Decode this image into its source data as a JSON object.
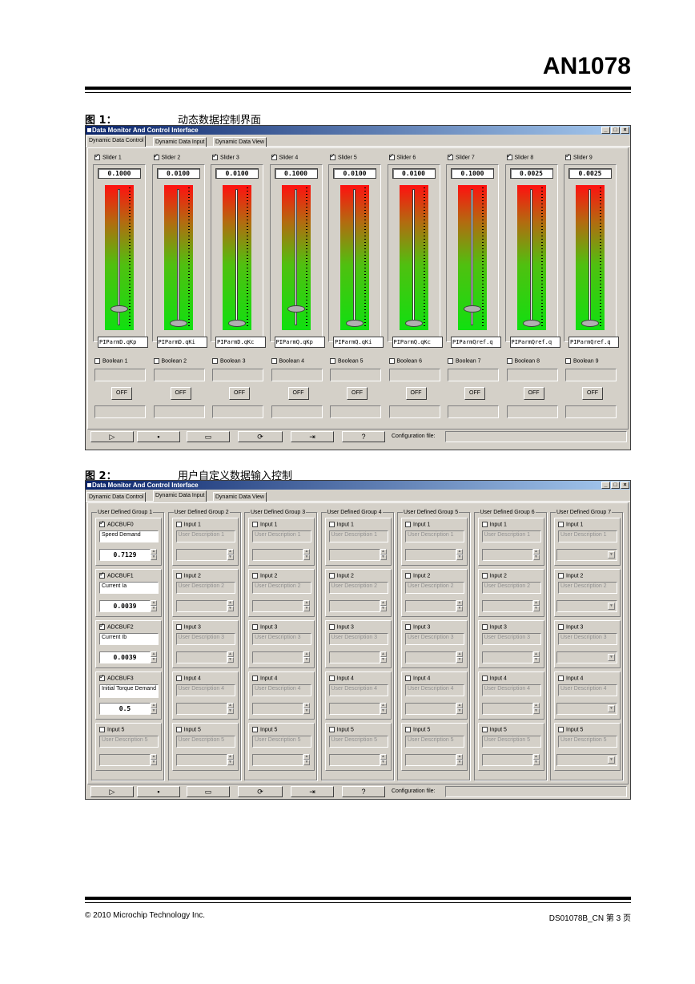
{
  "header": {
    "doc_id": "AN1078"
  },
  "figure1": {
    "caption_num": "图 1：",
    "caption_text": "动态数据控制界面",
    "window_title": "Data Monitor And Control Interface",
    "tabs": [
      "Dynamic Data Control",
      "Dynamic Data Input",
      "Dynamic Data View"
    ],
    "sliders": [
      {
        "label": "Slider 1",
        "value": "0.1000",
        "name": "PIParmD.qKp",
        "level": 0.12
      },
      {
        "label": "Slider 2",
        "value": "0.0100",
        "name": "PIParmD.qKi",
        "level": 0.01
      },
      {
        "label": "Slider 3",
        "value": "0.0100",
        "name": "PIParmD.qKc",
        "level": 0.01
      },
      {
        "label": "Slider 4",
        "value": "0.1000",
        "name": "PIParmQ.qKp",
        "level": 0.12
      },
      {
        "label": "Slider 5",
        "value": "0.0100",
        "name": "PIParmQ.qKi",
        "level": 0.01
      },
      {
        "label": "Slider 6",
        "value": "0.0100",
        "name": "PIParmQ.qKc",
        "level": 0.01
      },
      {
        "label": "Slider 7",
        "value": "0.1000",
        "name": "PIParmQref.q",
        "level": 0.12
      },
      {
        "label": "Slider 8",
        "value": "0.0025",
        "name": "PIParmQref.q",
        "level": 0.01
      },
      {
        "label": "Slider 9",
        "value": "0.0025",
        "name": "PIParmQref.q",
        "level": 0.01
      }
    ],
    "booleans": [
      "Boolean 1",
      "Boolean 2",
      "Boolean 3",
      "Boolean 4",
      "Boolean 5",
      "Boolean 6",
      "Boolean 7",
      "Boolean 8",
      "Boolean 9"
    ],
    "off_label": "OFF",
    "toolbar": {
      "play_icon": "▷",
      "save_icon": "▪",
      "open_icon": "▭",
      "refresh_icon": "⟳",
      "exit_icon": "⇥",
      "help_icon": "?",
      "config_label": "Configuration file:"
    }
  },
  "figure2": {
    "caption_num": "图 2：",
    "caption_text": "用户自定义数据输入控制",
    "window_title": "Data Monitor And Control Interface",
    "tabs": [
      "Dynamic Data Control",
      "Dynamic Data Input",
      "Dynamic Data View"
    ],
    "group_titles": [
      "User Defined Group 1",
      "User Defined Group 2",
      "User Defined Group 3",
      "User Defined Group 4",
      "User Defined Group 5",
      "User Defined Group 6",
      "User Defined Group 7"
    ],
    "group1": [
      {
        "label": "ADCBUF0",
        "desc": "Speed Demand",
        "value": "0.7129"
      },
      {
        "label": "ADCBUF1",
        "desc": "Current Ia",
        "value": "0.0039"
      },
      {
        "label": "ADCBUF2",
        "desc": "Current Ib",
        "value": "0.0039"
      },
      {
        "label": "ADCBUF3",
        "desc": "Initial Torque Demand",
        "value": "0.5"
      },
      {
        "label": "Input 5",
        "desc": "User Description 5",
        "value": ""
      }
    ],
    "inputs": [
      {
        "label": "Input 1",
        "desc": "User Description 1"
      },
      {
        "label": "Input 2",
        "desc": "User Description 2"
      },
      {
        "label": "Input 3",
        "desc": "User Description 3"
      },
      {
        "label": "Input 4",
        "desc": "User Description 4"
      },
      {
        "label": "Input 5",
        "desc": "User Description 5"
      }
    ],
    "toolbar": {
      "play_icon": "▷",
      "save_icon": "▪",
      "open_icon": "▭",
      "refresh_icon": "⟳",
      "exit_icon": "⇥",
      "help_icon": "?",
      "config_label": "Configuration file:"
    }
  },
  "footer": {
    "left": "© 2010 Microchip Technology Inc.",
    "right": "DS01078B_CN 第 3 页"
  }
}
